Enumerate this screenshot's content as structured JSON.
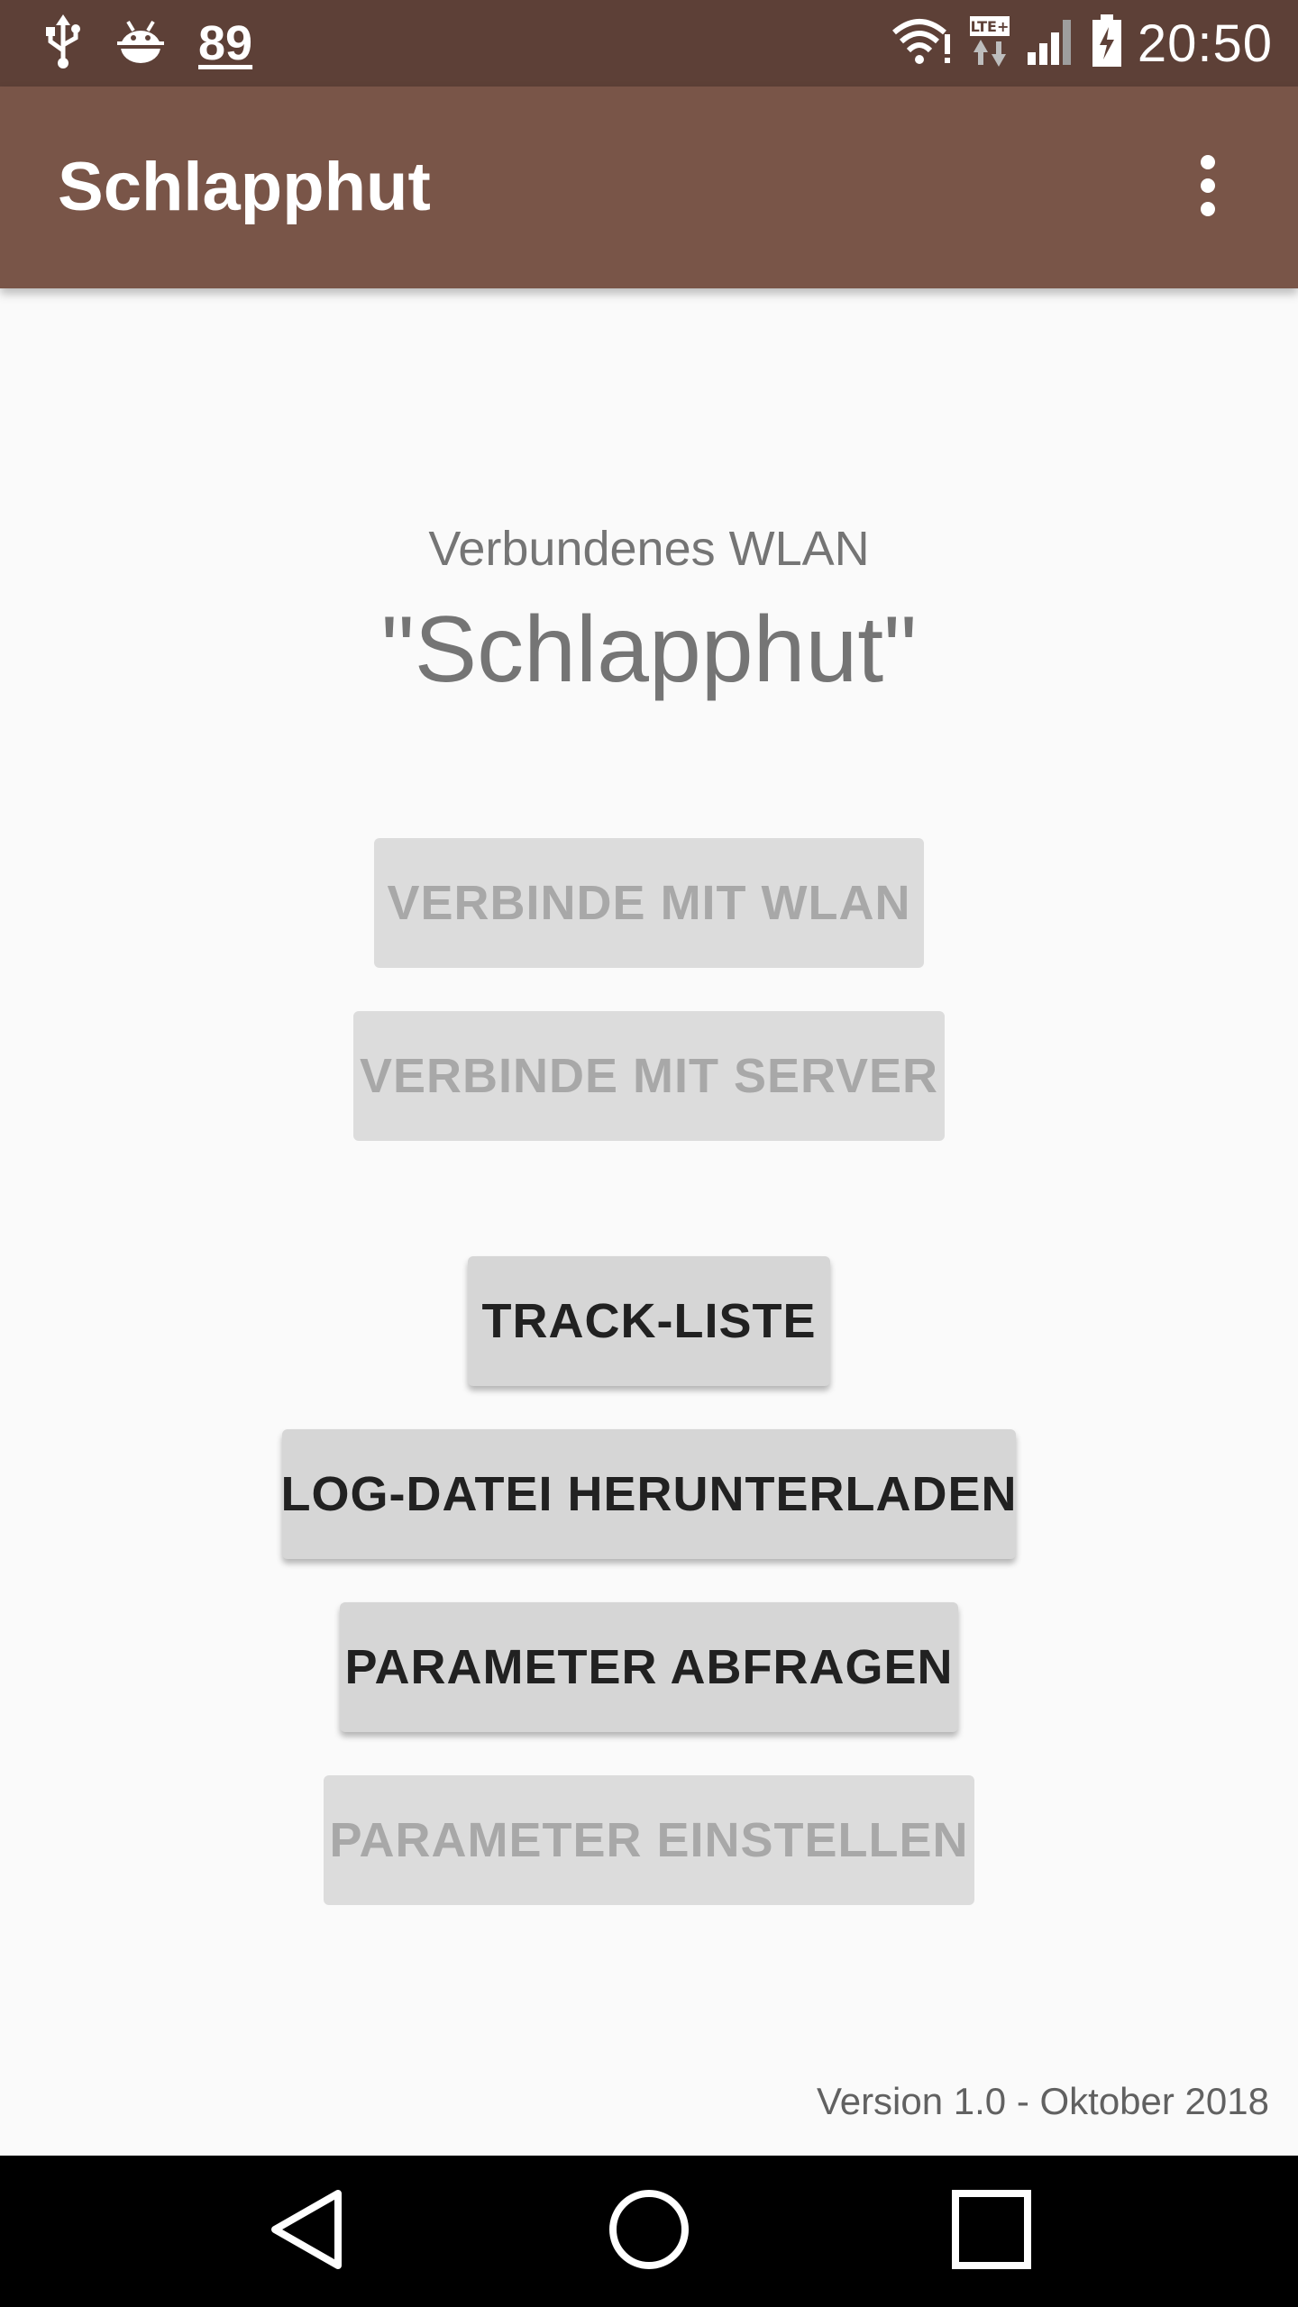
{
  "status_bar": {
    "left_icons": [
      "usb-icon",
      "android-debug-icon"
    ],
    "notification_count": "89",
    "right_icons": [
      "wifi-icon",
      "lte-icon",
      "signal-icon",
      "battery-charging-icon"
    ],
    "time": "20:50"
  },
  "app_bar": {
    "title": "Schlapphut",
    "menu_icon": "more-vert-icon"
  },
  "wlan": {
    "label": "Verbundenes WLAN",
    "name": "\"Schlapphut\""
  },
  "buttons": {
    "connect_wlan": "VERBINDE MIT WLAN",
    "connect_server": "VERBINDE MIT SERVER",
    "track_list": "TRACK-LISTE",
    "download_log": "LOG-DATEI HERUNTERLADEN",
    "query_params": "PARAMETER ABFRAGEN",
    "set_params": "PARAMETER EINSTELLEN"
  },
  "footer": {
    "version": "Version 1.0 - Oktober 2018"
  },
  "nav_bar": {
    "icons": [
      "back-icon",
      "home-icon",
      "recents-icon"
    ]
  },
  "colors": {
    "status_bar": "#5d4037",
    "app_bar": "#795548",
    "background": "#fafafa",
    "button_disabled_text": "#a8a8a8",
    "button_enabled_text": "#212121"
  }
}
